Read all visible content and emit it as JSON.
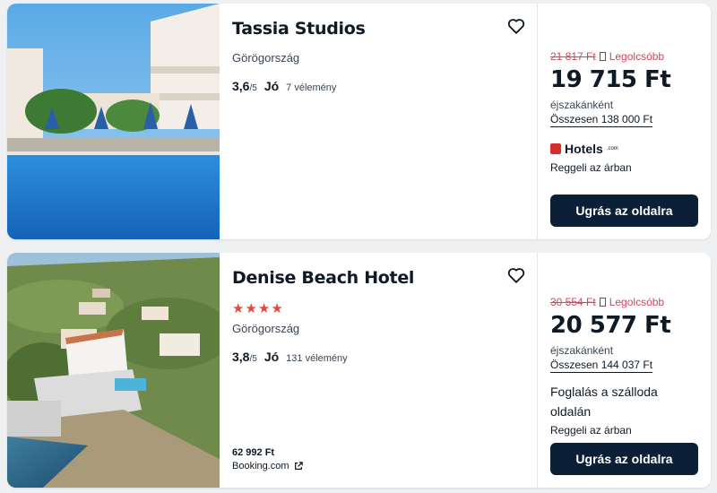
{
  "listings": [
    {
      "name": "Tassia Studios",
      "stars": "",
      "country": "Görögország",
      "rating_score": "3,6",
      "rating_max": "/5",
      "rating_word": "Jó",
      "reviews": "7 vélemény",
      "old_price": "21 817 Ft",
      "badge": "Legolcsóbb",
      "price": "19 715 Ft",
      "per_night": "éjszakánként",
      "total": "Összesen 138 000 Ft",
      "provider_logo": "Hotels",
      "provider_logo_suffix": ".com",
      "breakfast": "Reggeli az árban",
      "button": "Ugrás az oldalra"
    },
    {
      "name": "Denise Beach Hotel",
      "stars": "★★★★",
      "star_rating": 4,
      "country": "Görögország",
      "rating_score": "3,8",
      "rating_max": "/5",
      "rating_word": "Jó",
      "reviews": "131 vélemény",
      "old_price": "30 554 Ft",
      "badge": "Legolcsóbb",
      "price": "20 577 Ft",
      "per_night": "éjszakánként",
      "total": "Összesen 144 037 Ft",
      "provider_text": "Foglalás a szálloda oldalán",
      "breakfast": "Reggeli az árban",
      "button": "Ugrás az oldalra",
      "alt_price": "62 992 Ft",
      "alt_source": "Booking.com"
    }
  ],
  "colors": {
    "button_bg": "#0b2037",
    "old_price": "#d6455a",
    "stars": "#e04a3c",
    "hotels_logo": "#d32f2f"
  }
}
